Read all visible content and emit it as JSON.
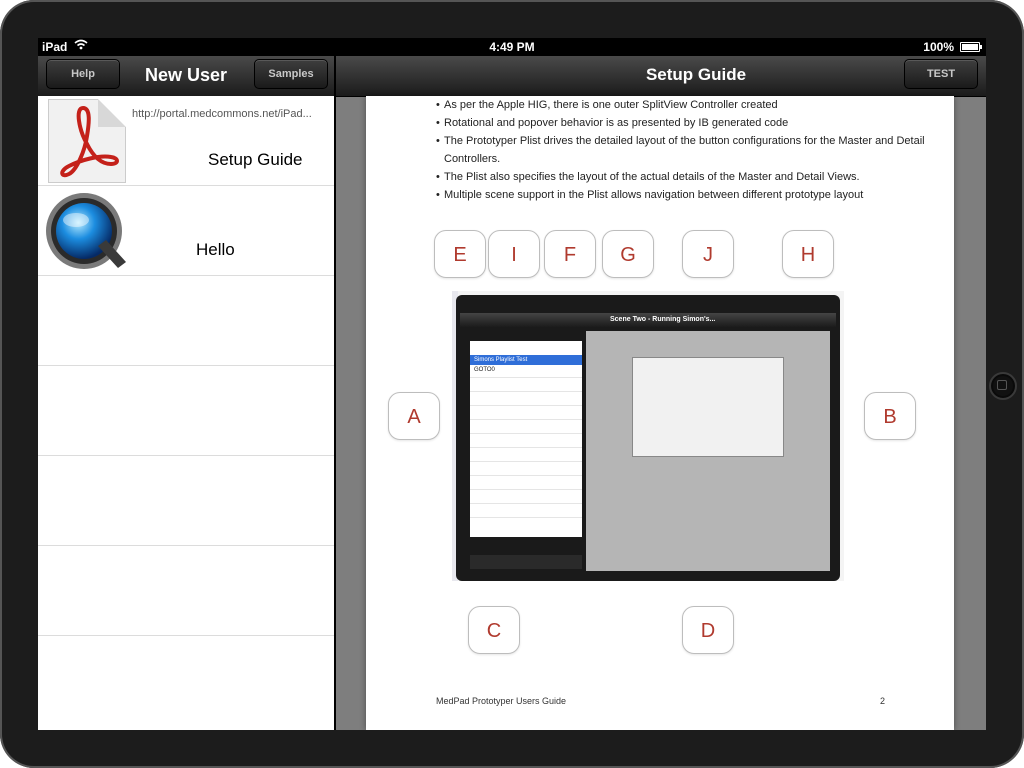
{
  "status": {
    "carrier": "iPad",
    "time": "4:49 PM",
    "battery": "100%"
  },
  "master": {
    "title": "New User",
    "left_button": "Help",
    "right_button": "Samples",
    "items": [
      {
        "url": "http://portal.medcommons.net/iPad...",
        "title": "Setup Guide",
        "icon": "pdf-icon"
      },
      {
        "url": "",
        "title": "Hello",
        "icon": "quicktime-icon"
      }
    ]
  },
  "detail": {
    "title": "Setup Guide",
    "right_button": "TEST",
    "bullets": [
      "As per the Apple HIG, there is  one outer SplitView Controller created",
      "Rotational and popover behavior is as presented by IB generated code",
      "The Prototyper Plist drives the detailed layout of the button configurations for the Master and Detail Controllers.",
      "The Plist also specifies the layout of the actual details of the Master and Detail Views.",
      "Multiple scene support in the Plist allows navigation between different prototype layout"
    ],
    "letter_buttons": {
      "E": "E",
      "I": "I",
      "F": "F",
      "G": "G",
      "J": "J",
      "H": "H",
      "A": "A",
      "B": "B",
      "C": "C",
      "D": "D"
    },
    "screenshot": {
      "title": "Scene Two - Running Simon's...",
      "selected_row": "Simons Playlist Test",
      "rows": [
        "GOTO0"
      ]
    },
    "footer_left": "MedPad Prototyper Users Guide",
    "footer_right": "2"
  },
  "colors": {
    "letter_text": "#b03a2e",
    "navbar_top": "#4a4a4a",
    "navbar_bottom": "#1b1b1b"
  }
}
